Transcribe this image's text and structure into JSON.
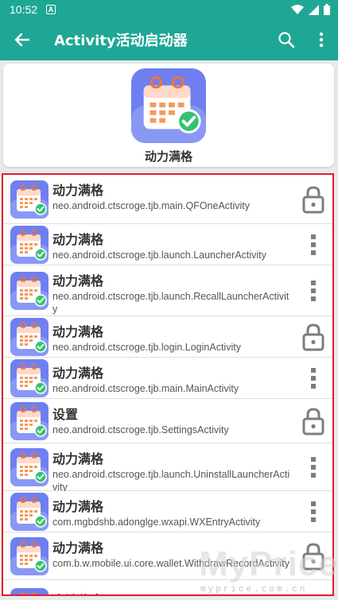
{
  "status": {
    "time": "10:52",
    "badge": "A"
  },
  "app_bar": {
    "title": "Activity活动启动器"
  },
  "header": {
    "app_name": "动力满格"
  },
  "list": [
    {
      "title": "动力满格",
      "subtitle": "neo.android.ctscroge.tjb.main.QFOneActivity",
      "action": "lock-icon"
    },
    {
      "title": "动力满格",
      "subtitle": "neo.android.ctscroge.tjb.launch.LauncherActivity",
      "action": "more-icon"
    },
    {
      "title": "动力满格",
      "subtitle": "neo.android.ctscroge.tjb.launch.RecallLauncherActivity",
      "action": "more-icon"
    },
    {
      "title": "动力满格",
      "subtitle": "neo.android.ctscroge.tjb.login.LoginActivity",
      "action": "lock-icon"
    },
    {
      "title": "动力满格",
      "subtitle": "neo.android.ctscroge.tjb.main.MainActivity",
      "action": "more-icon"
    },
    {
      "title": "设置",
      "subtitle": "neo.android.ctscroge.tjb.SettingsActivity",
      "action": "lock-icon"
    },
    {
      "title": "动力满格",
      "subtitle": "neo.android.ctscroge.tjb.launch.UninstallLauncherActivity",
      "action": "more-icon"
    },
    {
      "title": "动力满格",
      "subtitle": "com.mgbdshb.adonglge.wxapi.WXEntryActivity",
      "action": "more-icon"
    },
    {
      "title": "动力满格",
      "subtitle": "com.b.w.mobile.ui.core.wallet.WithdrawRecordActivity",
      "action": "lock-icon"
    },
    {
      "title": "电池信息",
      "subtitle": "",
      "action": ""
    }
  ],
  "watermark": {
    "text": "MyPrice",
    "url": "myprice.com.cn"
  },
  "colors": {
    "primary": "#1fa795",
    "highlight": "#e01f2a"
  }
}
